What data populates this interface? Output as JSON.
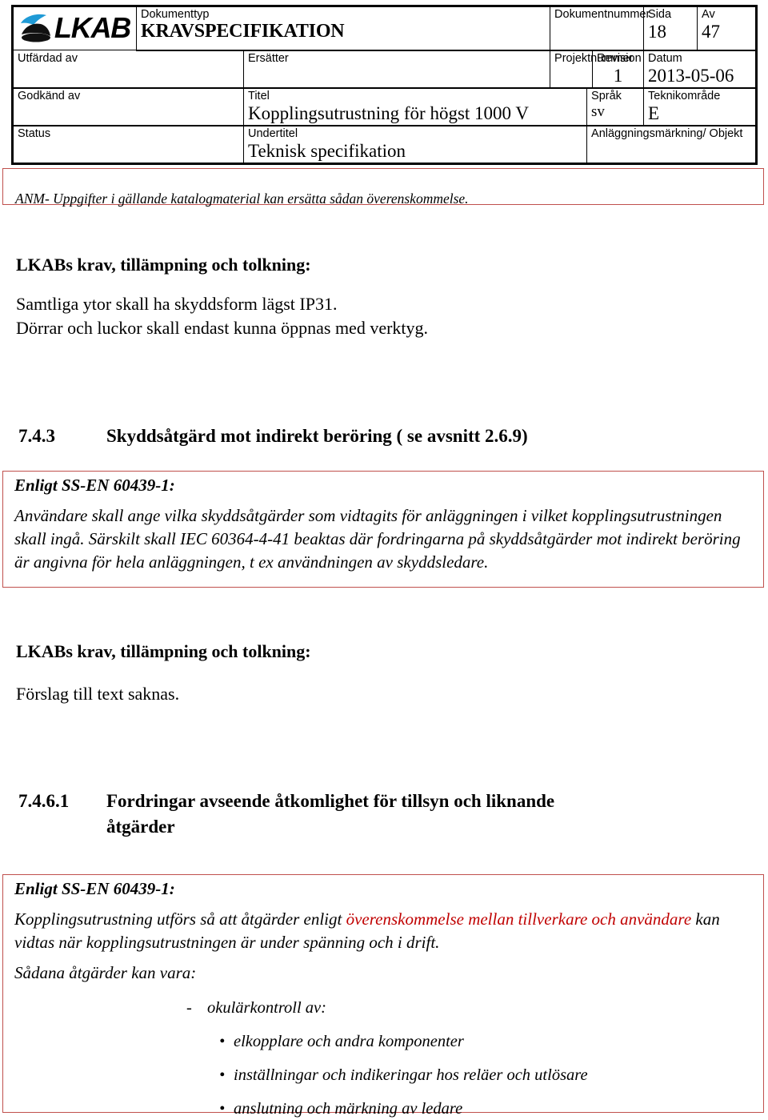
{
  "header": {
    "logo": {
      "brand": "LKAB",
      "mark_name": "lkab-logo-mark"
    },
    "fields": {
      "dokumenttyp_label": "Dokumenttyp",
      "dokumenttyp_value": "KRAVSPECIFIKATION",
      "dokumentnummer_label": "Dokumentnummer",
      "dokumentnummer_value": "",
      "sida_label": "Sida",
      "sida_value": "18",
      "av_label": "Av",
      "av_value": "47",
      "utfardad_av_label": "Utfärdad av",
      "utfardad_av_value": "",
      "ersatter_label": "Ersätter",
      "ersatter_value": "",
      "projektnummer_label": "Projektnummer",
      "projektnummer_value": "",
      "revision_label": "Revision",
      "revision_value": "1",
      "datum_label": "Datum",
      "datum_value": "2013-05-06",
      "godkand_av_label": "Godkänd av",
      "godkand_av_value": "",
      "titel_label": "Titel",
      "titel_value": "Kopplingsutrustning för högst 1000 V",
      "sprak_label": "Språk",
      "sprak_value": "sv",
      "teknikomrade_label": "Teknikområde",
      "teknikomrade_value": "E",
      "status_label": "Status",
      "status_value": "",
      "undertitel_label": "Undertitel",
      "undertitel_value": "Teknisk specifikation",
      "anlaggningsmarkning_label": "Anläggningsmärkning/ Objekt",
      "anlaggningsmarkning_value": ""
    }
  },
  "body": {
    "note_box": {
      "text": "ANM- Uppgifter i gällande katalogmaterial kan ersätta sådan överenskommelse."
    },
    "krav_block_1": {
      "heading": "LKABs krav, tillämpning och tolkning:",
      "line1": "Samtliga ytor skall ha skyddsform lägst IP31.",
      "line2": "Dörrar och luckor skall endast kunna öppnas med verktyg."
    },
    "section_743": {
      "number": "7.4.3",
      "title": "Skyddsåtgärd mot indirekt beröring ( se avsnitt 2.6.9)"
    },
    "quote_box_1": {
      "title": "Enligt SS-EN 60439-1:",
      "line1": "Användare skall ange vilka skyddsåtgärder som vidtagits för anläggningen i vilket kopplingsutrustningen",
      "line2": "skall ingå. Särskilt skall IEC 60364-4-41 beaktas där fordringarna på skyddsåtgärder mot indirekt beröring",
      "line3": "är angivna för hela anläggningen, t ex användningen av skyddsledare."
    },
    "krav_block_2": {
      "heading": "LKABs krav, tillämpning och tolkning:",
      "line1": "Förslag till text saknas."
    },
    "section_7461": {
      "number": "7.4.6.1",
      "title_line1": "Fordringar avseende åtkomlighet för tillsyn och liknande",
      "title_line2": "åtgärder"
    },
    "quote_box_2": {
      "title": "Enligt SS-EN 60439-1:",
      "para_part1": "Kopplingsutrustning utförs så att åtgärder enligt ",
      "para_red": "överenskommelse mellan tillverkare och användare",
      "para_part2": " kan",
      "para_line2": "vidtas när kopplingsutrustningen är under spänning och i drift.",
      "lead_in": "Sådana åtgärder kan vara:",
      "dash_item": {
        "mark": "-",
        "text": "okulärkontroll av:"
      },
      "bullets": [
        {
          "mark": "•",
          "text": "elkopplare och andra komponenter"
        },
        {
          "mark": "•",
          "text": "inställningar och indikeringar hos reläer och utlösare"
        },
        {
          "mark": "•",
          "text": "anslutning och märkning av ledare"
        }
      ]
    }
  },
  "colors": {
    "red_border": "#c0504d",
    "red_text": "#c00000",
    "logo_blue": "#1f9ad6",
    "logo_black": "#111111"
  }
}
